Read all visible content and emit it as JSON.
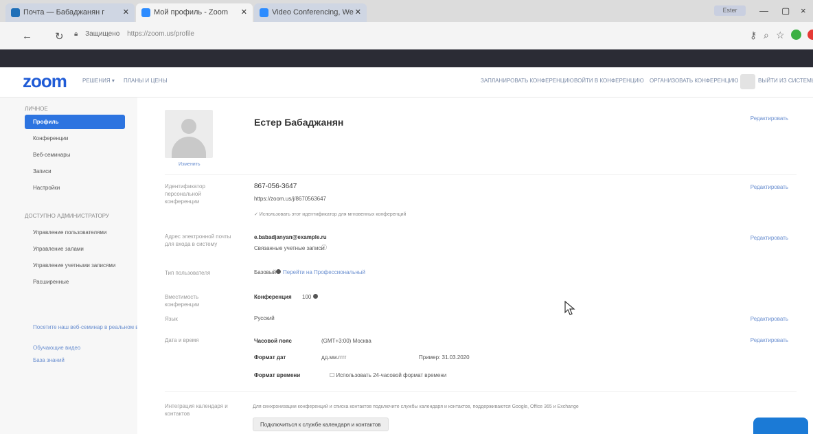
{
  "browser": {
    "tabs": [
      {
        "title": "Почта — Бабаджанян г",
        "active": false,
        "icon": "mail-icon"
      },
      {
        "title": "Мой профиль - Zoom",
        "active": true,
        "icon": "zoom-icon"
      },
      {
        "title": "Video Conferencing, We",
        "active": false,
        "icon": "zoom-icon"
      }
    ],
    "window_user": "Ester",
    "window_controls": [
      "—",
      "▢",
      "×"
    ],
    "url_secure_label": "Защищено",
    "url": "https://zoom.us/profile"
  },
  "header": {
    "logo": "zoom",
    "nav_left": [
      "РЕШЕНИЯ ▾",
      "ПЛАНЫ И ЦЕНЫ"
    ],
    "nav_right": [
      "ЗАПЛАНИРОВАТЬ КОНФЕРЕНЦИЮ",
      "ВОЙТИ В КОНФЕРЕНЦИЮ",
      "ОРГАНИЗОВАТЬ КОНФЕРЕНЦИЮ ▾"
    ],
    "user_name": "ВЫЙТИ ИЗ СИСТЕМЫ"
  },
  "sidebar": {
    "personal_head": "ЛИЧНОЕ",
    "items": [
      {
        "label": "Профиль",
        "active": true
      },
      {
        "label": "Конференции",
        "active": false
      },
      {
        "label": "Веб-семинары",
        "active": false
      },
      {
        "label": "Записи",
        "active": false
      },
      {
        "label": "Настройки",
        "active": false
      }
    ],
    "admin_head": "ДОСТУПНО АДМИНИСТРАТОРУ",
    "admin_items": [
      "Управление пользователями",
      "Управление залами",
      "Управление учетными записями",
      "Расширенные"
    ],
    "links": [
      "Посетите наш веб-семинар в реальном времени",
      "Обучающие видео",
      "База знаний"
    ]
  },
  "profile": {
    "photo_caption": "Изменить",
    "name": "Естер Бабаджанян",
    "edit_label": "Редактировать",
    "pmi_label": "Идентификатор персональной конференции",
    "pmi_value": "867-056-3647",
    "pmi_url": "https://zoom.us/j/8670563647",
    "pmi_note": "✓ Использовать этот идентификатор для мгновенных конференций",
    "email_label": "Адрес электронной почты для входа в систему",
    "email_value": "e.babadjanyan@example.ru",
    "email_visibility": "Связанные учетные записи",
    "account_type_label": "Тип пользователя",
    "account_type_value": "Базовый",
    "account_upgrade": "Перейти на Профессиональный",
    "capacity_label": "Вместимость конференции",
    "capacity_name": "Конференция",
    "capacity_value": "100",
    "language_label": "Язык",
    "language_value": "Русский",
    "datetime_label": "Дата и время",
    "tz_label": "Часовой пояс",
    "tz_value": "(GMT+3:00) Москва",
    "date_format_label": "Формат дат",
    "date_format_value": "дд.мм.гггг",
    "date_example": "Пример: 31.03.2020",
    "time_format_label": "Формат времени",
    "time_format_value": "☐ Использовать 24-часовой формат времени",
    "integration_label": "Интеграция календаря и контактов",
    "integration_text": "Для синхронизации конференций и списка контактов подключите службы календаря и контактов, поддерживаются Google, Office 365 и Exchange",
    "integration_button": "Подключиться к службе календаря и контактов"
  }
}
